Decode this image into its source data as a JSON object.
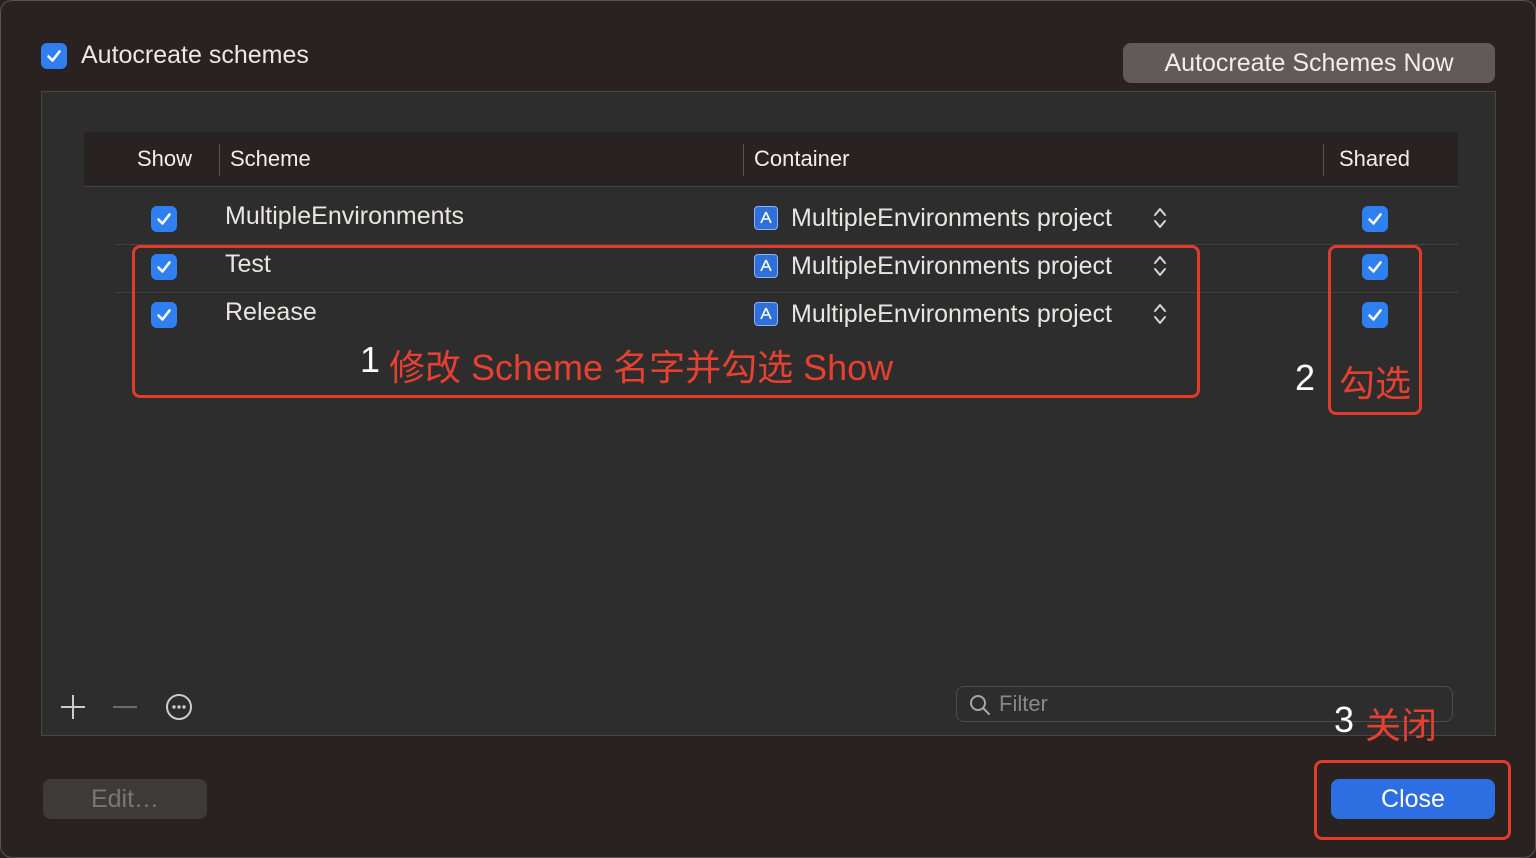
{
  "autocreate": {
    "label": "Autocreate schemes",
    "checked": true
  },
  "autocreate_now_button": "Autocreate Schemes Now",
  "table": {
    "columns": {
      "show": "Show",
      "scheme": "Scheme",
      "container": "Container",
      "shared": "Shared"
    },
    "rows": [
      {
        "show": true,
        "scheme": "MultipleEnvironments",
        "container": "MultipleEnvironments project",
        "shared": true
      },
      {
        "show": true,
        "scheme": "Test",
        "container": "MultipleEnvironments project",
        "shared": true
      },
      {
        "show": true,
        "scheme": "Release",
        "container": "MultipleEnvironments project",
        "shared": true
      }
    ]
  },
  "annotations": {
    "a1": {
      "number": "1",
      "text": "修改 Scheme 名字并勾选 Show"
    },
    "a2": {
      "number": "2",
      "text": "勾选"
    },
    "a3": {
      "number": "3",
      "text": "关闭"
    }
  },
  "toolbar": {
    "add_icon": "plus-icon",
    "remove_icon": "minus-icon",
    "more_icon": "ellipsis-circle-icon"
  },
  "filter": {
    "placeholder": "Filter",
    "value": ""
  },
  "buttons": {
    "edit": "Edit…",
    "close": "Close"
  },
  "colors": {
    "accent": "#2f7ff0",
    "annotation": "#e03c2b",
    "background": "#2a2220"
  }
}
